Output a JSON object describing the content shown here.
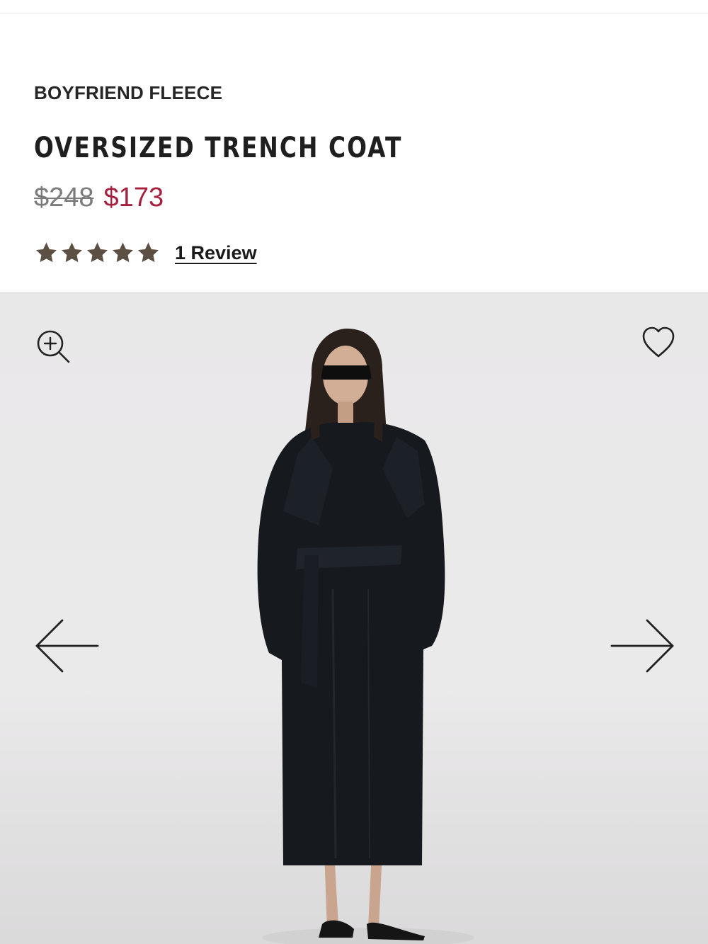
{
  "product": {
    "brand": "BOYFRIEND FLEECE",
    "title": "OVERSIZED TRENCH COAT",
    "price_original": "$248",
    "price_sale": "$173",
    "rating": {
      "value": 5,
      "max": 5
    },
    "review_link": "1 Review"
  },
  "colors": {
    "sale_price": "#a51f3e",
    "original_price": "#7b7b7b",
    "star": "#5b5043",
    "text": "#1f1f1f",
    "gallery_bg": "#e9e8e9",
    "coat": "#16191e"
  },
  "gallery": {
    "icons": {
      "zoom": "zoom-in-icon",
      "wishlist": "heart-icon",
      "previous": "arrow-left-icon",
      "next": "arrow-right-icon"
    }
  }
}
